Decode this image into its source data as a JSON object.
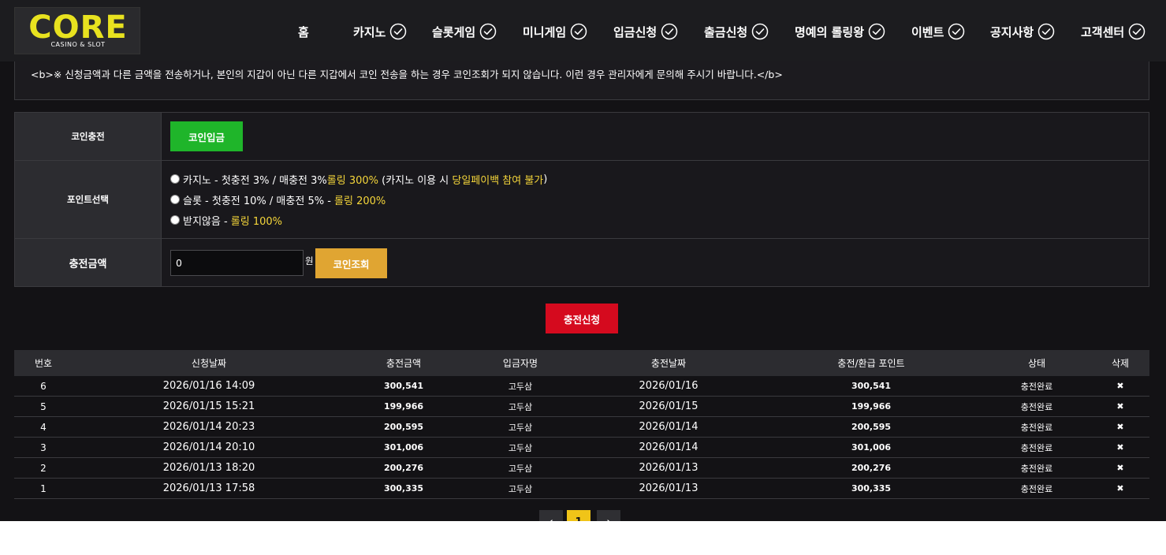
{
  "brand": {
    "logo_text": "CORE",
    "logo_subtext": "CASINO & SLOT"
  },
  "nav": {
    "items": [
      {
        "label": "홈",
        "has_check": false
      },
      {
        "label": "카지노",
        "has_check": true
      },
      {
        "label": "슬롯게임",
        "has_check": true
      },
      {
        "label": "미니게임",
        "has_check": true
      },
      {
        "label": "입금신청",
        "has_check": true
      },
      {
        "label": "출금신청",
        "has_check": true
      },
      {
        "label": "명예의 롤링왕",
        "has_check": true
      },
      {
        "label": "이벤트",
        "has_check": true
      },
      {
        "label": "공지사항",
        "has_check": true
      },
      {
        "label": "고객센터",
        "has_check": true
      }
    ]
  },
  "notice": {
    "text": "<b>※ 신청금액과 다른 금액을 전송하거나, 본인의 지갑이 아닌 다른 지갑에서 코인 전송을 하는 경우 코인조회가 되지 않습니다. 이런 경우 관리자에게 문의해 주시기 바랍니다.</b>"
  },
  "form": {
    "coin_charge": {
      "label": "코인충전",
      "button": "코인입금"
    },
    "point_select": {
      "label": "포인트선택",
      "options": [
        {
          "text": "카지노 - 첫충전 3% / 매충전 3% ",
          "highlight": "롤링 300%",
          "suffix_open": " (카지노 이용 시 ",
          "suffix_highlight": "당일페이백 참여 불가",
          "suffix_close": ")"
        },
        {
          "text": "슬롯 - 첫충전 10% / 매충전 5% - ",
          "highlight": "롤링 200%",
          "suffix_open": "",
          "suffix_highlight": "",
          "suffix_close": ""
        },
        {
          "text": "받지않음 - ",
          "highlight": "롤링 100%",
          "suffix_open": "",
          "suffix_highlight": "",
          "suffix_close": ""
        }
      ]
    },
    "amount": {
      "label": "충전금액",
      "value": "0",
      "unit": "원",
      "button": "코인조회"
    },
    "submit_label": "충전신청"
  },
  "history": {
    "columns": [
      "번호",
      "신청날짜",
      "충전금액",
      "입금자명",
      "충전날짜",
      "충전/환급 포인트",
      "상태",
      "삭제"
    ],
    "rows": [
      {
        "no": "6",
        "request_date": "2026/01/16 14:09",
        "amount": "300,541",
        "depositor": "고두삼",
        "charge_date": "2026/01/16",
        "points": "300,541",
        "status": "충전완료",
        "delete": "✖"
      },
      {
        "no": "5",
        "request_date": "2026/01/15 15:21",
        "amount": "199,966",
        "depositor": "고두삼",
        "charge_date": "2026/01/15",
        "points": "199,966",
        "status": "충전완료",
        "delete": "✖"
      },
      {
        "no": "4",
        "request_date": "2026/01/14 20:23",
        "amount": "200,595",
        "depositor": "고두삼",
        "charge_date": "2026/01/14",
        "points": "200,595",
        "status": "충전완료",
        "delete": "✖"
      },
      {
        "no": "3",
        "request_date": "2026/01/14 20:10",
        "amount": "301,006",
        "depositor": "고두삼",
        "charge_date": "2026/01/14",
        "points": "301,006",
        "status": "충전완료",
        "delete": "✖"
      },
      {
        "no": "2",
        "request_date": "2026/01/13 18:20",
        "amount": "200,276",
        "depositor": "고두삼",
        "charge_date": "2026/01/13",
        "points": "200,276",
        "status": "충전완료",
        "delete": "✖"
      },
      {
        "no": "1",
        "request_date": "2026/01/13 17:58",
        "amount": "300,335",
        "depositor": "고두삼",
        "charge_date": "2026/01/13",
        "points": "300,335",
        "status": "충전완료",
        "delete": "✖"
      }
    ]
  },
  "pagination": {
    "prev": "‹",
    "current": "1",
    "next": "›"
  },
  "colors": {
    "accent_yellow": "#f5d63a",
    "green": "#1fb52a",
    "orange": "#e0a532",
    "red": "#d50a1e",
    "background": "#131215"
  }
}
